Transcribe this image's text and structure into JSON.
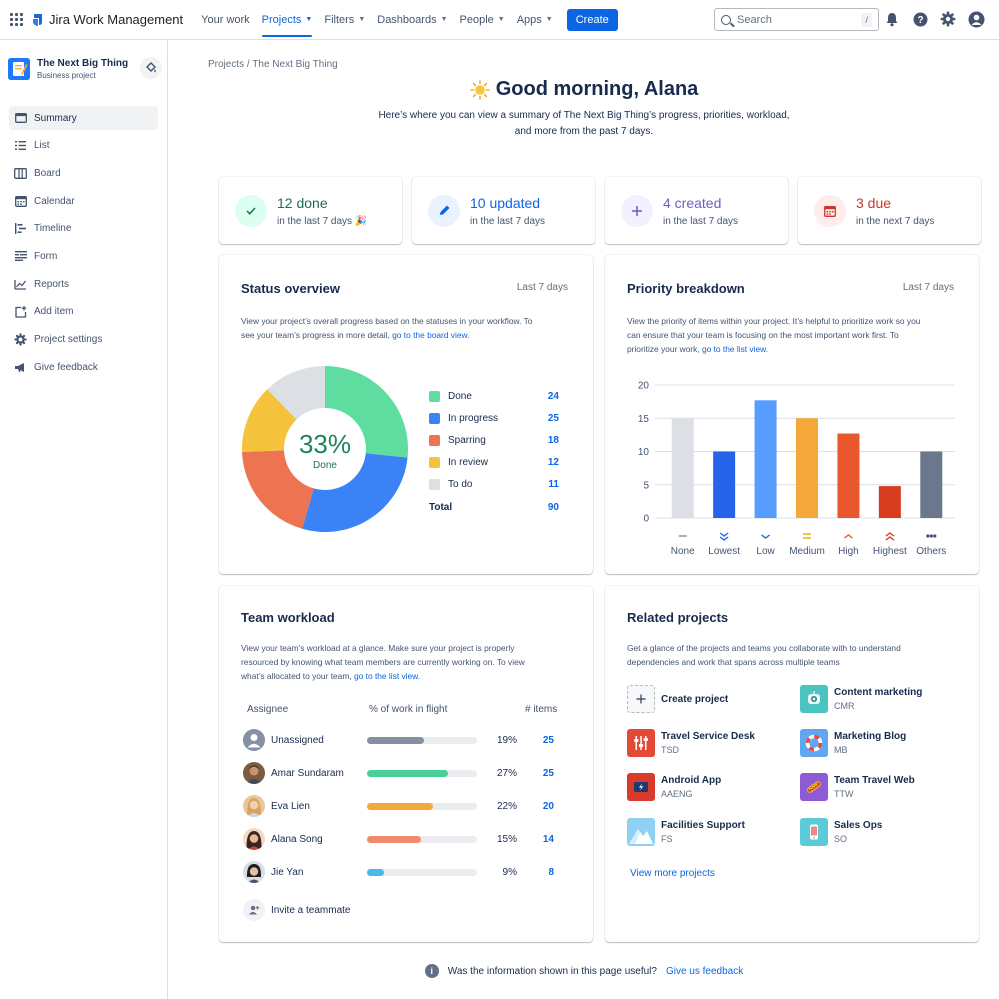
{
  "app": {
    "name": "Jira Work Management"
  },
  "nav": {
    "items": [
      "Your work",
      "Projects",
      "Filters",
      "Dashboards",
      "People",
      "Apps"
    ],
    "create_label": "Create",
    "search_placeholder": "Search",
    "search_shortcut": "/"
  },
  "project": {
    "name": "The Next Big Thing",
    "type": "Business project"
  },
  "sidebar": {
    "items": [
      {
        "label": "Summary",
        "icon": "summary-icon"
      },
      {
        "label": "List",
        "icon": "list-icon"
      },
      {
        "label": "Board",
        "icon": "board-icon"
      },
      {
        "label": "Calendar",
        "icon": "calendar-icon"
      },
      {
        "label": "Timeline",
        "icon": "timeline-icon"
      },
      {
        "label": "Form",
        "icon": "form-icon"
      },
      {
        "label": "Reports",
        "icon": "reports-icon"
      },
      {
        "label": "Add item",
        "icon": "add-item-icon"
      },
      {
        "label": "Project settings",
        "icon": "gear-icon"
      },
      {
        "label": "Give feedback",
        "icon": "megaphone-icon"
      }
    ]
  },
  "breadcrumb": "Projects / The Next Big Thing",
  "greeting": {
    "title": "Good morning, Alana",
    "subtitle_line1": "Here’s where you can view a summary of The Next Big Thing’s progress, priorities, workload,",
    "subtitle_line2": "and more from the past 7 days."
  },
  "stats": [
    {
      "main": "12 done",
      "sub": "in the last 7 days 🎉",
      "color": "#216E4E",
      "bg": "#DCFFF1",
      "icon": "check-icon"
    },
    {
      "main": "10 updated",
      "sub": "in the last 7 days",
      "color": "#0C66E4",
      "bg": "#E9F2FF",
      "icon": "pencil-icon"
    },
    {
      "main": "4 created",
      "sub": "in the last 7 days",
      "color": "#6E5DC6",
      "bg": "#F3F0FF",
      "icon": "plus-icon"
    },
    {
      "main": "3 due",
      "sub": "in the next 7 days",
      "color": "#C9372C",
      "bg": "#FFECEB",
      "icon": "calendar-icon"
    }
  ],
  "status_overview": {
    "title": "Status overview",
    "period": "Last 7 days",
    "desc_line1": "View your project’s overall progress based on the statuses in your workflow. To",
    "desc_line2_prefix": "see your team’s progress in more detail,",
    "desc_link": "go to the board view",
    "center_value": "33%",
    "center_label": "Done",
    "total_label": "Total",
    "total_value": "90",
    "items": [
      {
        "label": "Done",
        "value": "24",
        "color": "#5FDDA0"
      },
      {
        "label": "In progress",
        "value": "25",
        "color": "#3B82F6"
      },
      {
        "label": "Sparring",
        "value": "18",
        "color": "#EE7350"
      },
      {
        "label": "In review",
        "value": "12",
        "color": "#F5C33B"
      },
      {
        "label": "To do",
        "value": "11",
        "color": "#DCDFE4"
      }
    ]
  },
  "priority_breakdown": {
    "title": "Priority breakdown",
    "period": "Last 7 days",
    "desc_line1": "View the priority of items within your project. It’s helpful to prioritize work so you",
    "desc_line2": "can ensure that your team is focusing on the most important work first. To",
    "desc_line3_prefix": "prioritize your work,",
    "desc_link": "go to the list view"
  },
  "chart_data": {
    "type": "bar",
    "categories": [
      "None",
      "Lowest",
      "Low",
      "Medium",
      "High",
      "Highest",
      "Others"
    ],
    "values": [
      15,
      10,
      17.7,
      15,
      12.7,
      4.8,
      10
    ],
    "colors": [
      "#DCDFE4",
      "#2563EB",
      "#579DFF",
      "#F5A83A",
      "#E9572C",
      "#D63C1E",
      "#6B778C"
    ],
    "yticks": [
      "0",
      "5",
      "10",
      "15",
      "20"
    ],
    "ylim": [
      0,
      20
    ],
    "grid": true,
    "xlabel": "",
    "ylabel": ""
  },
  "team_workload": {
    "title": "Team workload",
    "desc_line1": "View your team’s workload at a glance. Make sure your project is properly",
    "desc_line2": "resourced by knowing what team members are currently working on. To view",
    "desc_line3_prefix": "what’s allocated to your team,",
    "desc_link": "go to the list view",
    "col_assignee": "Assignee",
    "col_work": "% of work in flight",
    "col_items": "# items",
    "rows": [
      {
        "name": "Unassigned",
        "pct": "19%",
        "fill": 0.52,
        "count": "25",
        "color": "#8590A2",
        "avatar_bg": "#8590A2"
      },
      {
        "name": "Amar Sundaram",
        "pct": "27%",
        "fill": 0.74,
        "count": "25",
        "color": "#4BCE97",
        "avatar_bg": "#7A5C3E"
      },
      {
        "name": "Eva Lien",
        "pct": "22%",
        "fill": 0.6,
        "count": "20",
        "color": "#F5A83A",
        "avatar_bg": "#D9A25E"
      },
      {
        "name": "Alana Song",
        "pct": "15%",
        "fill": 0.49,
        "count": "14",
        "color": "#F08A6C",
        "avatar_bg": "#4A2F2A"
      },
      {
        "name": "Jie Yan",
        "pct": "9%",
        "fill": 0.15,
        "count": "8",
        "color": "#4DB8E8",
        "avatar_bg": "#3A3A3A"
      }
    ],
    "invite_label": "Invite a teammate"
  },
  "related_projects": {
    "title": "Related projects",
    "desc_line1": "Get a glance of the projects and teams you collaborate with to understand",
    "desc_line2": "dependencies and work that spans across multiple teams",
    "create_label": "Create project",
    "items": [
      {
        "name": "Content marketing",
        "key": "CMR",
        "color": "#4BC4C1",
        "icon": "robot-icon"
      },
      {
        "name": "Travel Service Desk",
        "key": "TSD",
        "color": "#E34935",
        "icon": "sliders-icon"
      },
      {
        "name": "Marketing Blog",
        "key": "MB",
        "color": "#5FA7F2",
        "icon": "lifebuoy-icon"
      },
      {
        "name": "Android App",
        "key": "AAENG",
        "color": "#D93A2B",
        "icon": "card-icon"
      },
      {
        "name": "Team Travel Web",
        "key": "TTW",
        "color": "#8E5BD6",
        "icon": "hotdog-icon"
      },
      {
        "name": "Facilities Support",
        "key": "FS",
        "color": "#8FD0F5",
        "icon": "mountain-icon"
      },
      {
        "name": "Sales Ops",
        "key": "SO",
        "color": "#5CCBD6",
        "icon": "phone-icon"
      }
    ],
    "view_more": "View more projects"
  },
  "feedback": {
    "question": "Was the information shown in this page useful?",
    "link": "Give us feedback"
  }
}
